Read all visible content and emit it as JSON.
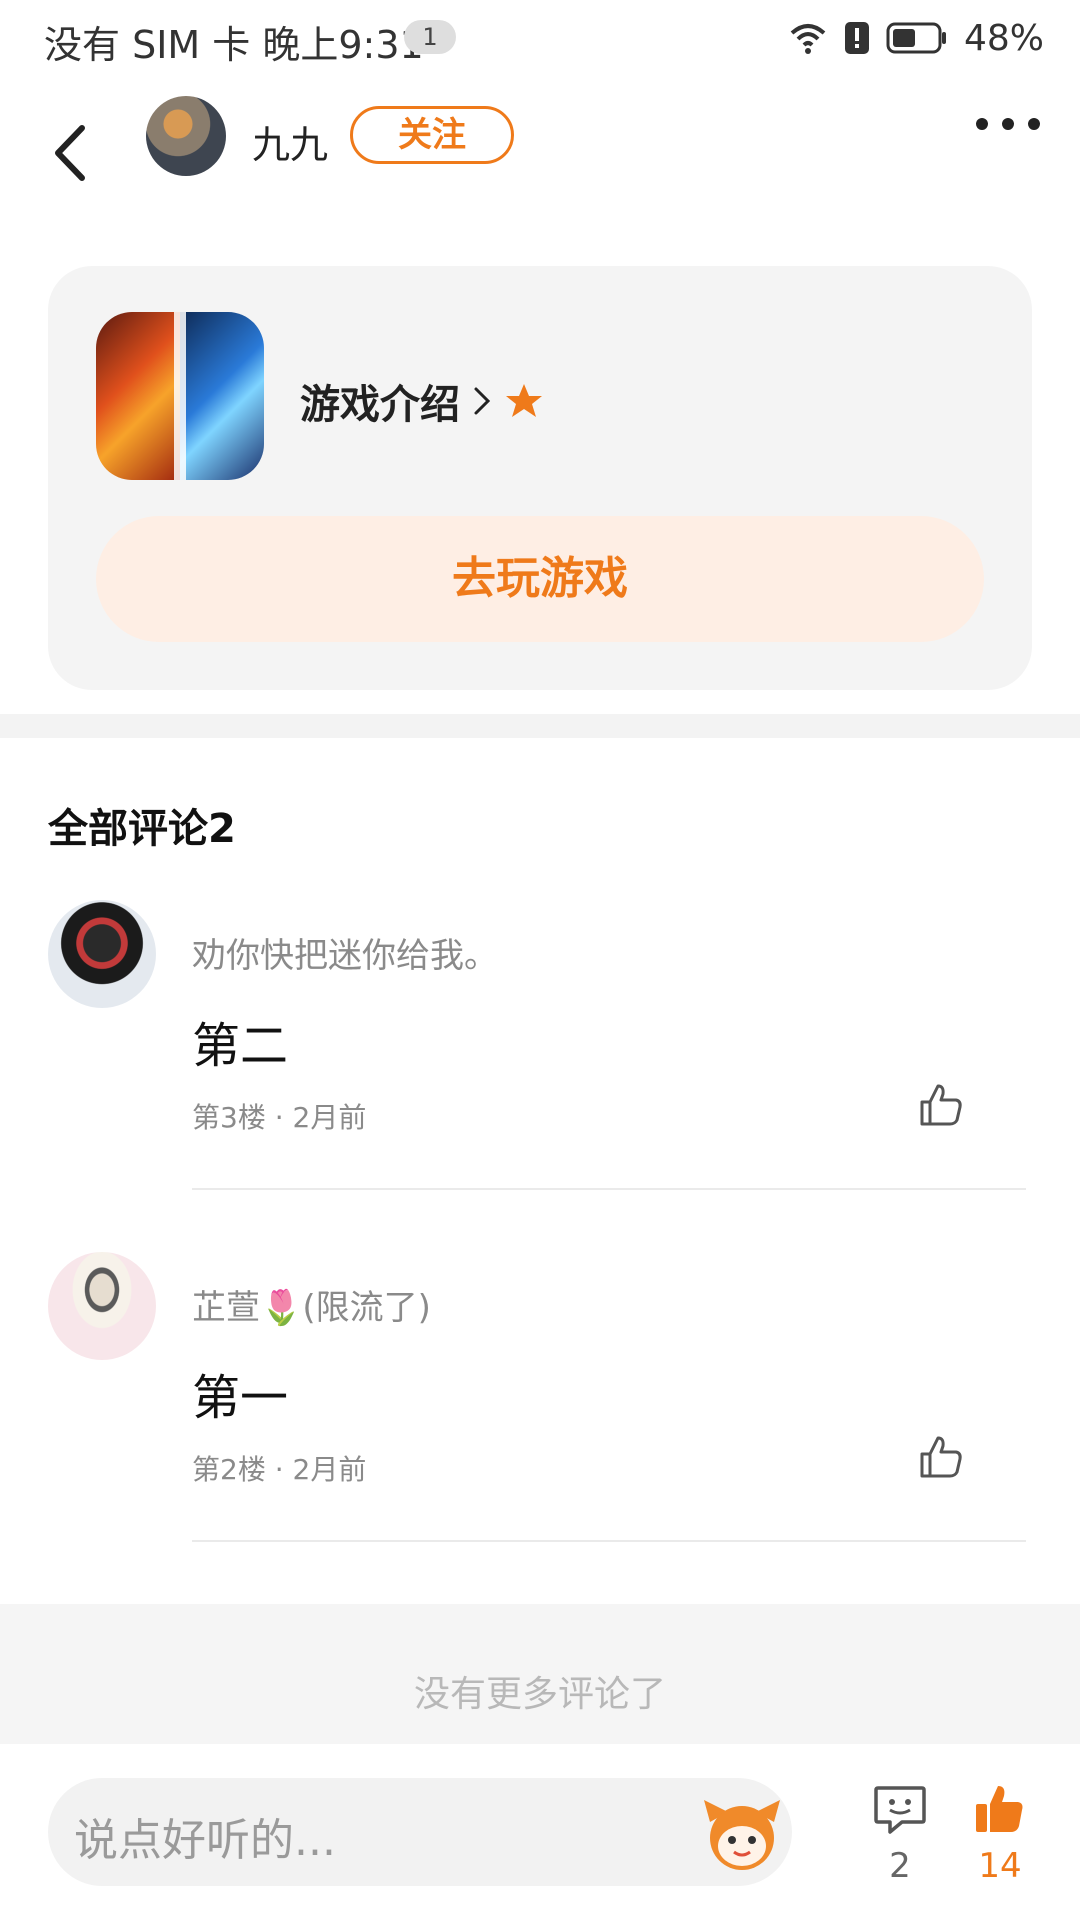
{
  "status_bar": {
    "carrier_time": "没有 SIM 卡 晚上9:31",
    "notification_count": "1",
    "battery_pct": "48%",
    "icons": [
      "wifi-icon",
      "alert-icon",
      "battery-icon"
    ]
  },
  "header": {
    "back_icon": "chevron-left-icon",
    "username": "九九",
    "follow_label": "关注",
    "more_icon": "more-dots-icon"
  },
  "game_card": {
    "intro_label": "游戏介绍",
    "intro_icons": [
      "chevron-right-icon",
      "star-icon"
    ],
    "play_button_label": "去玩游戏"
  },
  "comments": {
    "title": "全部评论2",
    "items": [
      {
        "name": "劝你快把迷你给我。",
        "text": "第二",
        "meta": "第3楼 · 2月前"
      },
      {
        "name": "芷萱🌷(限流了)",
        "text": "第一",
        "meta": "第2楼 · 2月前"
      }
    ],
    "no_more_text": "没有更多评论了"
  },
  "bottom_bar": {
    "input_placeholder": "说点好听的...",
    "comment_count": "2",
    "like_count": "14"
  },
  "colors": {
    "accent": "#ef7a1a",
    "accent_light": "#feeee4",
    "card_bg": "#f4f4f4",
    "text_primary": "#111111",
    "text_secondary": "#8a8a8a"
  }
}
